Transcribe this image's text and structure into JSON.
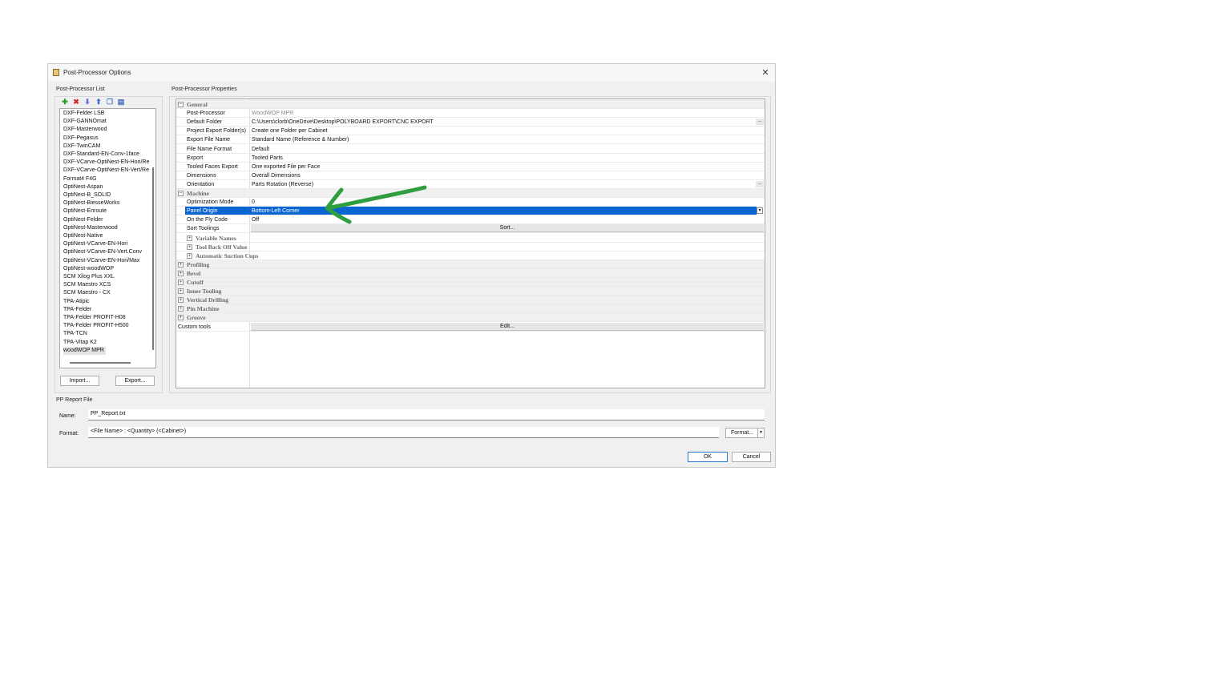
{
  "window": {
    "title": "Post-Processor Options",
    "close_glyph": "✕"
  },
  "pp_list": {
    "group_label": "Post-Processor List",
    "toolbar_icons": [
      "add-icon",
      "delete-icon",
      "move-down-icon",
      "move-up-icon",
      "copy-icon",
      "edit-icon"
    ],
    "items": [
      "DXF-Felder LSB",
      "DXF-GANNOmat",
      "DXF-Masterwood",
      "DXF-Pegasus",
      "DXF-TwinCAM",
      "DXF-Standard-EN-Conv-1face",
      "DXF-VCarve-OptiNest-EN-Hori/Re",
      "DXF-VCarve-OptiNest-EN-Vert/Re",
      "Format4 F4G",
      "OptiNest-Aspan",
      "OptiNest-B_SOLID",
      "OptiNest-BiesseWorks",
      "OptiNest-Enroute",
      "OptiNest-Felder",
      "OptiNest-Masterwood",
      "OptiNest-Native",
      "OptiNest-VCarve-EN-Hori",
      "OptiNest-VCarve-EN-Vert.Conv",
      "OptiNest-VCarve-EN-Hori/Max",
      "OptiNest-woodWOP",
      "SCM Xilog Plus XXL",
      "SCM Maestro XCS",
      "SCM Maestro - CX",
      "TPA-Atipic",
      "TPA-Felder",
      "TPA-Felder PROFIT-H08",
      "TPA-Felder PROFIT-H500",
      "TPA-TCN",
      "TPA-Vitap K2",
      "woodWOP MPR"
    ],
    "selected": "woodWOP MPR",
    "import_label": "Import...",
    "export_label": "Export..."
  },
  "props": {
    "group_label": "Post-Processor Properties",
    "rows": [
      {
        "type": "cat",
        "name": "General",
        "expander": "−"
      },
      {
        "type": "prop",
        "name": "Post-Processor",
        "value": "WoodWOP MPR",
        "grey": true
      },
      {
        "type": "prop",
        "name": "Default Folder",
        "value": "C:\\Users\\clorb\\OneDrive\\Desktop\\POLYBOARD EXPORT\\CNC EXPORT",
        "ellipsis": true
      },
      {
        "type": "prop",
        "name": "Project Export Folder(s)",
        "value": "Create one Folder per Cabinet"
      },
      {
        "type": "prop",
        "name": "Export File Name",
        "value": "Standard Name (Reference & Number)"
      },
      {
        "type": "prop",
        "name": "File Name Format",
        "value": "Default"
      },
      {
        "type": "prop",
        "name": "Export",
        "value": "Tooled Parts"
      },
      {
        "type": "prop",
        "name": "Tooled Faces Export",
        "value": "One exported File per Face"
      },
      {
        "type": "prop",
        "name": "Dimensions",
        "value": "Overall Dimensions"
      },
      {
        "type": "prop",
        "name": "Orientation",
        "value": "Parts Rotation (Reverse)",
        "ellipsis": true
      },
      {
        "type": "cat",
        "name": "Machine",
        "expander": "−"
      },
      {
        "type": "prop",
        "name": "Optimization Mode",
        "value": "0"
      },
      {
        "type": "prop",
        "name": "Panel Origin",
        "value": "Bottom-Left Corner",
        "highlight": true,
        "dropdown": true
      },
      {
        "type": "prop",
        "name": "On the Fly Code",
        "value": "Off"
      },
      {
        "type": "button",
        "name": "Sort Toolings",
        "button": "Sort..."
      },
      {
        "type": "subcat",
        "name": "Variable Names",
        "expander": "+"
      },
      {
        "type": "subcat",
        "name": "Tool Back Off Value",
        "expander": "+"
      },
      {
        "type": "subcat",
        "name": "Automatic Suction Cups",
        "expander": "+"
      },
      {
        "type": "cat",
        "name": "Profiling",
        "expander": "+"
      },
      {
        "type": "cat",
        "name": "Bevel",
        "expander": "+"
      },
      {
        "type": "cat",
        "name": "Cutoff",
        "expander": "+"
      },
      {
        "type": "cat",
        "name": "Inner Tooling",
        "expander": "+"
      },
      {
        "type": "cat",
        "name": "Vertical Drilling",
        "expander": "+"
      },
      {
        "type": "cat",
        "name": "Pin Machine",
        "expander": "+"
      },
      {
        "type": "cat",
        "name": "Groove",
        "expander": "+"
      },
      {
        "type": "button-root",
        "name": "Custom tools",
        "button": "Edit..."
      }
    ],
    "ellipsis_glyph": "...",
    "dropdown_glyph": "▼"
  },
  "report": {
    "group_label": "PP Report File",
    "name_label": "Name:",
    "name_value": "PP_Report.txt",
    "format_label": "Format:",
    "format_value": "<File Name> : <Quantity> (<Cabinet>)",
    "format_button": "Format...",
    "dropdown_glyph": "▼"
  },
  "footer": {
    "ok_label": "OK",
    "cancel_label": "Cancel"
  },
  "colors": {
    "highlight": "#0a64d2",
    "annotation_arrow": "#2e9e3e"
  }
}
